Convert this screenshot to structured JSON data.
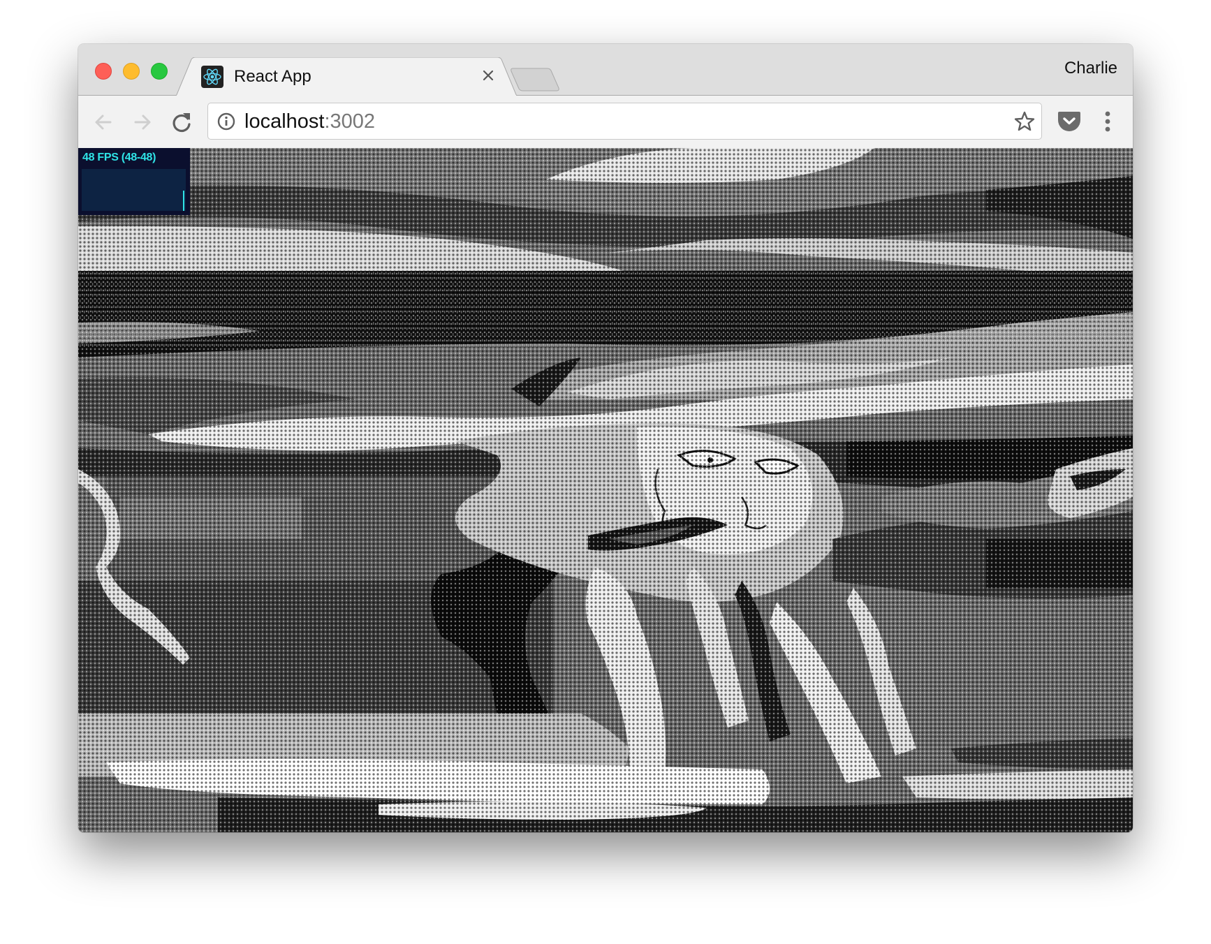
{
  "browser": {
    "tab": {
      "title": "React App",
      "favicon": "react-logo-icon",
      "close_icon": "close-icon"
    },
    "new_tab_icon": "new-tab-icon",
    "profile_name": "Charlie",
    "nav": {
      "back_icon": "arrow-left-icon",
      "forward_icon": "arrow-right-icon",
      "reload_icon": "reload-icon"
    },
    "omnibox": {
      "security_icon": "info-icon",
      "host": "localhost",
      "port": ":3002",
      "bookmark_icon": "star-icon"
    },
    "extensions": [
      {
        "name": "Pocket",
        "icon": "pocket-icon"
      }
    ],
    "menu_icon": "more-vertical-icon"
  },
  "page": {
    "fps_meter": {
      "label": "48 FPS (48-48)",
      "fps": 48,
      "min": 48,
      "max": 48,
      "accent_color": "#2fe3e6",
      "background_color": "#0b0f2e"
    },
    "canvas": {
      "description": "Glitched black-and-white halftone rendering of a face with horizontal wave distortion"
    }
  },
  "colors": {
    "traffic_red": "#fe5f57",
    "traffic_yellow": "#febc2e",
    "traffic_green": "#28c840",
    "react_cyan": "#61dafb"
  }
}
